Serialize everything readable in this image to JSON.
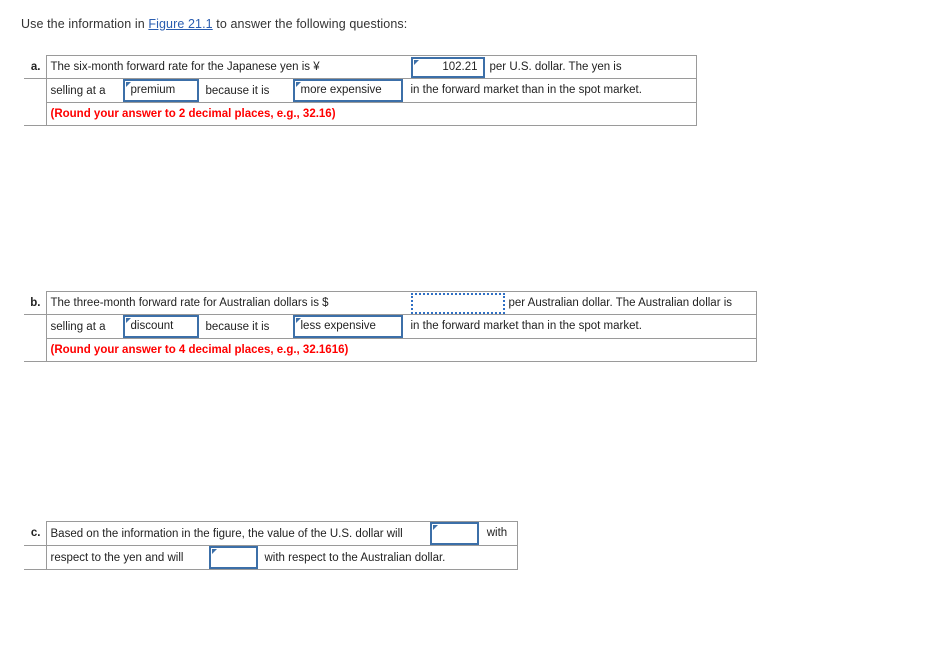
{
  "intro": {
    "before": "Use the information in ",
    "link_label": "Figure 21.1",
    "after": " to answer the following questions:"
  },
  "questions": [
    {
      "letter": "a.",
      "row1_prefix": "The six-month forward rate for the Japanese yen is ¥",
      "answer_value": "102.21",
      "row1_suffix": "per U.S. dollar. The yen is",
      "row2_label_1": "selling at a",
      "row2_select_1": "premium",
      "row2_label_2": "because it is",
      "row2_select_2": "more expensive",
      "row2_tail": "in the forward market than in the spot market.",
      "hint": "(Round your answer to 2 decimal places, e.g., 32.16)"
    },
    {
      "letter": "b.",
      "row1_prefix": "The three-month forward rate for Australian dollars is $",
      "answer_value": "",
      "row1_suffix": "per Australian dollar. The Australian dollar is",
      "row2_label_1": "selling at a",
      "row2_select_1": "discount",
      "row2_label_2": "because it is",
      "row2_select_2": "less expensive",
      "row2_tail": "in the forward market than in the spot market.",
      "hint": "(Round your answer to 4 decimal places, e.g., 32.1616)"
    },
    {
      "letter": "c.",
      "row1_prefix": "Based on the information in the figure, the value of the U.S. dollar will",
      "row1_select": "",
      "row1_suffix": "with",
      "row2_prefix": "respect to the yen and will",
      "row2_select": "",
      "row2_suffix": "with respect to the Australian dollar."
    }
  ],
  "colors": {
    "link": "#2a5db0",
    "control_border": "#3c6fa8",
    "focus_border": "#2f6fc4",
    "hint_red": "#ff0000",
    "table_border": "#9a9a9a"
  },
  "icons": {
    "corner_flag": "triangle-flag-icon"
  }
}
